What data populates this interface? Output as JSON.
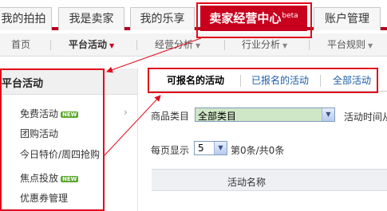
{
  "top_tabs": [
    {
      "label": "我的拍拍"
    },
    {
      "label": "我是卖家"
    },
    {
      "label": "我的乐享"
    },
    {
      "label": "卖家经营中心",
      "sup": "beta"
    },
    {
      "label": "账户管理"
    }
  ],
  "sub_nav": [
    {
      "label": "首页"
    },
    {
      "label": "平台活动"
    },
    {
      "label": "经营分析"
    },
    {
      "label": "行业分析"
    },
    {
      "label": "平台规则"
    }
  ],
  "sidebar": {
    "title": "平台活动",
    "items": [
      {
        "label": "免费活动",
        "badge": "NEW"
      },
      {
        "label": "团购活动"
      },
      {
        "label": "今日特价/周四抢购"
      },
      {
        "label": "焦点投放",
        "badge": "NEW"
      },
      {
        "label": "优惠券管理"
      }
    ]
  },
  "content_tabs": [
    {
      "label": "可报名的活动"
    },
    {
      "label": "已报名的活动"
    },
    {
      "label": "全部活动"
    }
  ],
  "filters": {
    "category_label": "商品类目",
    "category_value": "全部类目",
    "time_label": "活动时间从",
    "per_page_label": "每页显示",
    "per_page_value": "5",
    "count_text": "第0条/共0条"
  },
  "table": {
    "columns": [
      "活动名称"
    ]
  },
  "colors": {
    "brand_red": "#c8001e",
    "annotation_red": "#e2091b",
    "link_blue": "#1a5ca8",
    "new_badge_green": "#5aa82a"
  }
}
